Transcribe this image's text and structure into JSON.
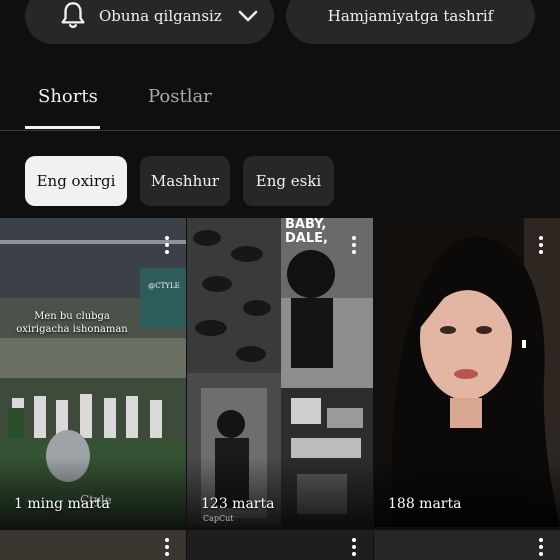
{
  "actions": {
    "subscribe_label": "Obuna qilgansiz",
    "community_label": "Hamjamiyatga tashrif"
  },
  "tabs": [
    {
      "label": "Shorts",
      "active": true
    },
    {
      "label": "Postlar",
      "active": false
    }
  ],
  "chips": [
    {
      "label": "Eng oxirgi",
      "active": true
    },
    {
      "label": "Mashhur",
      "active": false
    },
    {
      "label": "Eng eski",
      "active": false
    }
  ],
  "shorts": [
    {
      "views": "1 ming marta",
      "overlay_text": "Men bu clubga oxirigacha ishonaman",
      "watermark": "Ctyle",
      "tag": "@CTYLE"
    },
    {
      "views": "123 marta",
      "overlay_text": "BABY, DALE,",
      "watermark": "CapCut"
    },
    {
      "views": "188 marta"
    }
  ],
  "colors": {
    "background": "#0f0f0f",
    "surface": "#272727",
    "text_primary": "#f1f1f1",
    "text_secondary": "#aaaaaa"
  }
}
